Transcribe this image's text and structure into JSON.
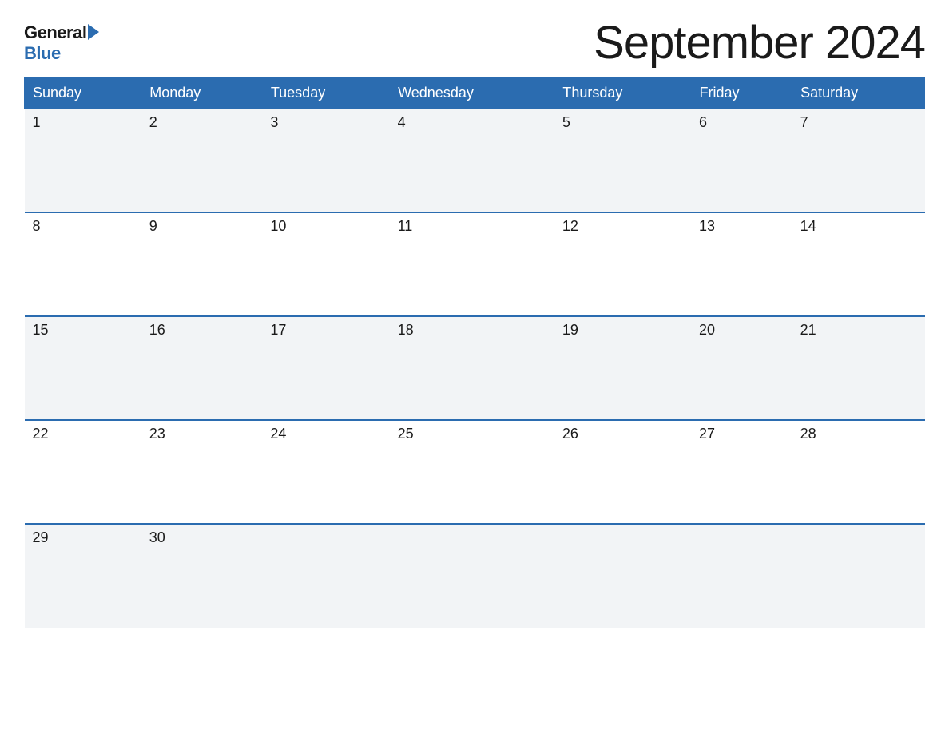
{
  "logo": {
    "general_text": "General",
    "blue_text": "Blue"
  },
  "title": "September 2024",
  "days_of_week": [
    "Sunday",
    "Monday",
    "Tuesday",
    "Wednesday",
    "Thursday",
    "Friday",
    "Saturday"
  ],
  "weeks": [
    [
      1,
      2,
      3,
      4,
      5,
      6,
      7
    ],
    [
      8,
      9,
      10,
      11,
      12,
      13,
      14
    ],
    [
      15,
      16,
      17,
      18,
      19,
      20,
      21
    ],
    [
      22,
      23,
      24,
      25,
      26,
      27,
      28
    ],
    [
      29,
      30,
      null,
      null,
      null,
      null,
      null
    ]
  ],
  "colors": {
    "header_bg": "#2b6cb0",
    "header_text": "#ffffff",
    "odd_row_bg": "#f2f4f6",
    "even_row_bg": "#ffffff",
    "border_color": "#2b6cb0",
    "day_text": "#1a1a1a"
  }
}
